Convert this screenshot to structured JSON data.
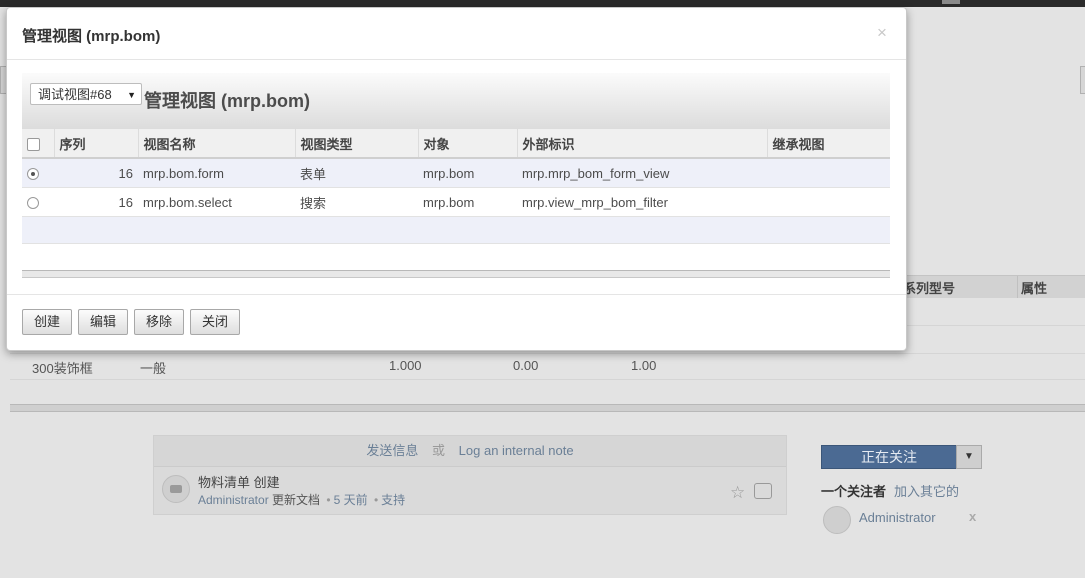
{
  "background": {
    "table_headers": [
      "系列型号",
      "属性"
    ],
    "row": {
      "name": "300装饰框",
      "type": "一般",
      "qty": "1.000",
      "col3": "0.00",
      "col4": "1.00"
    },
    "chatter": {
      "send_message": "发送信息",
      "or": "或",
      "log_note": "Log an internal note",
      "message_title": "物料清单 创建",
      "message_author": "Administrator",
      "message_action": "更新文档",
      "message_time": "5 天前",
      "message_support": "支持"
    },
    "follow_button": "正在关注",
    "followers_label": "一个关注者",
    "add_followers": "加入其它的",
    "follower_name": "Administrator",
    "follower_remove": "x"
  },
  "modal": {
    "title": "管理视图 (mrp.bom)",
    "close": "×",
    "select_value": "调试视图#68",
    "view_title": "管理视图 (mrp.bom)",
    "columns": [
      "序列",
      "视图名称",
      "视图类型",
      "对象",
      "外部标识",
      "继承视图"
    ],
    "rows": [
      {
        "selected": true,
        "sequence": "16",
        "name": "mrp.bom.form",
        "type": "表单",
        "model": "mrp.bom",
        "xml_id": "mrp.mrp_bom_form_view",
        "inherit": ""
      },
      {
        "selected": false,
        "sequence": "16",
        "name": "mrp.bom.select",
        "type": "搜索",
        "model": "mrp.bom",
        "xml_id": "mrp.view_mrp_bom_filter",
        "inherit": ""
      }
    ],
    "buttons": {
      "create": "创建",
      "edit": "编辑",
      "remove": "移除",
      "close": "关闭"
    }
  },
  "colors": {
    "accent": "#4b6a93",
    "row_highlight": "#eef0f9"
  }
}
